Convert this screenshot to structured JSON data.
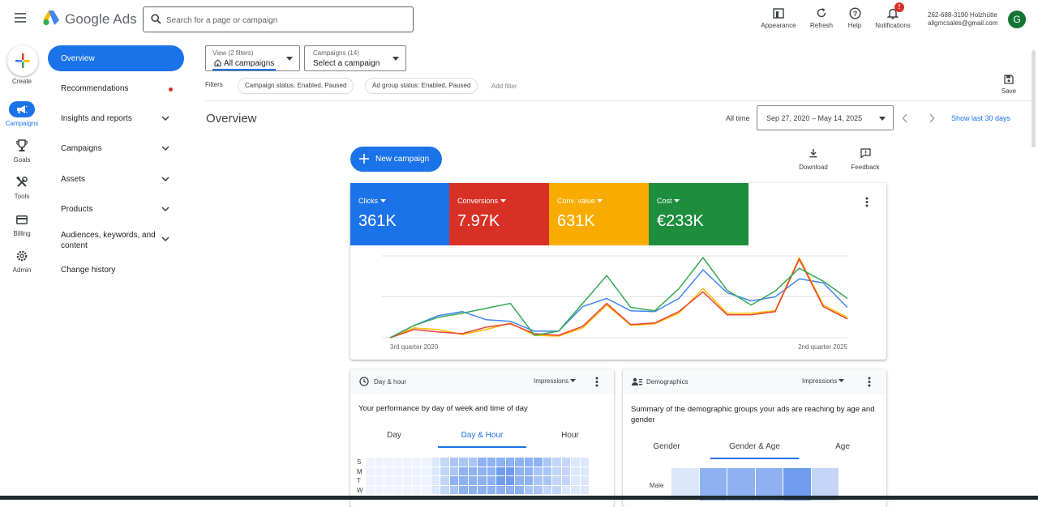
{
  "header": {
    "brand": "Google Ads",
    "search_placeholder": "Search for a page or campaign",
    "tools": [
      {
        "label": "Appearance",
        "icon": "appearance-icon"
      },
      {
        "label": "Refresh",
        "icon": "refresh-icon"
      },
      {
        "label": "Help",
        "icon": "help-icon"
      },
      {
        "label": "Notifications",
        "icon": "notifications-icon",
        "badge": "!"
      }
    ],
    "account_line1": "262-688-3190 Holzhütte",
    "account_line2": "allgmcsales@gmail.com",
    "avatar_letter": "G"
  },
  "rail": {
    "create_label": "Create",
    "items": [
      {
        "label": "Campaigns",
        "icon": "campaigns-icon",
        "active": true
      },
      {
        "label": "Goals",
        "icon": "goals-icon"
      },
      {
        "label": "Tools",
        "icon": "tools-icon"
      },
      {
        "label": "Billing",
        "icon": "billing-icon"
      },
      {
        "label": "Admin",
        "icon": "admin-icon"
      }
    ]
  },
  "nav": {
    "items": [
      {
        "label": "Overview",
        "active": true
      },
      {
        "label": "Recommendations",
        "dot": true
      },
      {
        "label": "Insights and reports",
        "expandable": true
      },
      {
        "label": "Campaigns",
        "expandable": true
      },
      {
        "label": "Assets",
        "expandable": true
      },
      {
        "label": "Products",
        "expandable": true
      },
      {
        "label": "Audiences, keywords, and content",
        "expandable": true
      },
      {
        "label": "Change history"
      }
    ]
  },
  "filters": {
    "view_small": "View (2 filters)",
    "view_value": "All campaigns",
    "campaigns_small": "Campaigns (14)",
    "campaigns_value": "Select a campaign",
    "filters_label": "Filters",
    "chips": [
      "Campaign status: Enabled, Paused",
      "Ad group status: Enabled, Paused"
    ],
    "add_filter": "Add filter",
    "save_label": "Save"
  },
  "overview": {
    "title": "Overview",
    "all_time": "All time",
    "date_range": "Sep 27, 2020 – May 14, 2025",
    "show_last": "Show last 30 days",
    "new_campaign": "New campaign",
    "download": "Download",
    "feedback": "Feedback"
  },
  "metrics": [
    {
      "name": "Clicks",
      "value": "361K",
      "color": "#1a73e8"
    },
    {
      "name": "Conversions",
      "value": "7.97K",
      "color": "#d93025"
    },
    {
      "name": "Conv. value",
      "value": "631K",
      "color": "#f9ab00"
    },
    {
      "name": "Cost",
      "value": "€233K",
      "color": "#1e8e3e"
    }
  ],
  "chart_data": {
    "type": "line",
    "x_tick_labels": [
      "3rd quarter 2020",
      "2nd quarter 2025"
    ],
    "grid": true,
    "ylim": [
      0,
      100
    ],
    "series": [
      {
        "name": "Clicks",
        "color": "#4285f4",
        "values": [
          0,
          15,
          27,
          32,
          22,
          20,
          8,
          8,
          38,
          48,
          33,
          32,
          48,
          83,
          55,
          45,
          50,
          72,
          67,
          37
        ]
      },
      {
        "name": "Conversions",
        "color": "#ea4335",
        "values": [
          0,
          10,
          7,
          5,
          13,
          17,
          5,
          3,
          14,
          42,
          16,
          18,
          32,
          56,
          28,
          28,
          32,
          96,
          38,
          23
        ]
      },
      {
        "name": "Conv. value",
        "color": "#fbbc04",
        "values": [
          0,
          12,
          10,
          4,
          10,
          18,
          3,
          2,
          12,
          40,
          15,
          17,
          30,
          60,
          30,
          30,
          33,
          98,
          40,
          25
        ]
      },
      {
        "name": "Cost",
        "color": "#34a853",
        "values": [
          0,
          15,
          25,
          30,
          36,
          42,
          3,
          8,
          42,
          76,
          37,
          33,
          60,
          98,
          58,
          40,
          57,
          85,
          69,
          48
        ]
      }
    ]
  },
  "dayhour": {
    "title": "Day & hour",
    "metric": "Impressions",
    "subtitle": "Your performance by day of week and time of day",
    "tabs": [
      "Day",
      "Day & Hour",
      "Hour"
    ],
    "active_tab": 1,
    "rows": [
      "S",
      "M",
      "T",
      "W"
    ],
    "intensity": [
      [
        1,
        1,
        1,
        1,
        1,
        1,
        1,
        2,
        3,
        4,
        4,
        4,
        5,
        5,
        5,
        5,
        5,
        5,
        5,
        4,
        3,
        3,
        2,
        2
      ],
      [
        1,
        1,
        1,
        1,
        1,
        1,
        1,
        2,
        3,
        4,
        5,
        5,
        5,
        5,
        6,
        6,
        5,
        5,
        4,
        4,
        3,
        3,
        2,
        2
      ],
      [
        1,
        1,
        1,
        1,
        1,
        1,
        1,
        2,
        3,
        5,
        5,
        5,
        5,
        5,
        6,
        6,
        5,
        5,
        4,
        4,
        3,
        3,
        2,
        2
      ],
      [
        1,
        1,
        1,
        1,
        1,
        1,
        1,
        2,
        3,
        4,
        5,
        5,
        5,
        5,
        5,
        5,
        5,
        4,
        4,
        3,
        3,
        2,
        2,
        2
      ]
    ]
  },
  "demographics": {
    "title": "Demographics",
    "metric": "Impressions",
    "subtitle": "Summary of the demographic groups your ads are reaching by age and gender",
    "tabs": [
      "Gender",
      "Gender & Age",
      "Age"
    ],
    "active_tab": 1,
    "row_label": "Male",
    "intensity": [
      2,
      5,
      5,
      5,
      6,
      3
    ]
  }
}
